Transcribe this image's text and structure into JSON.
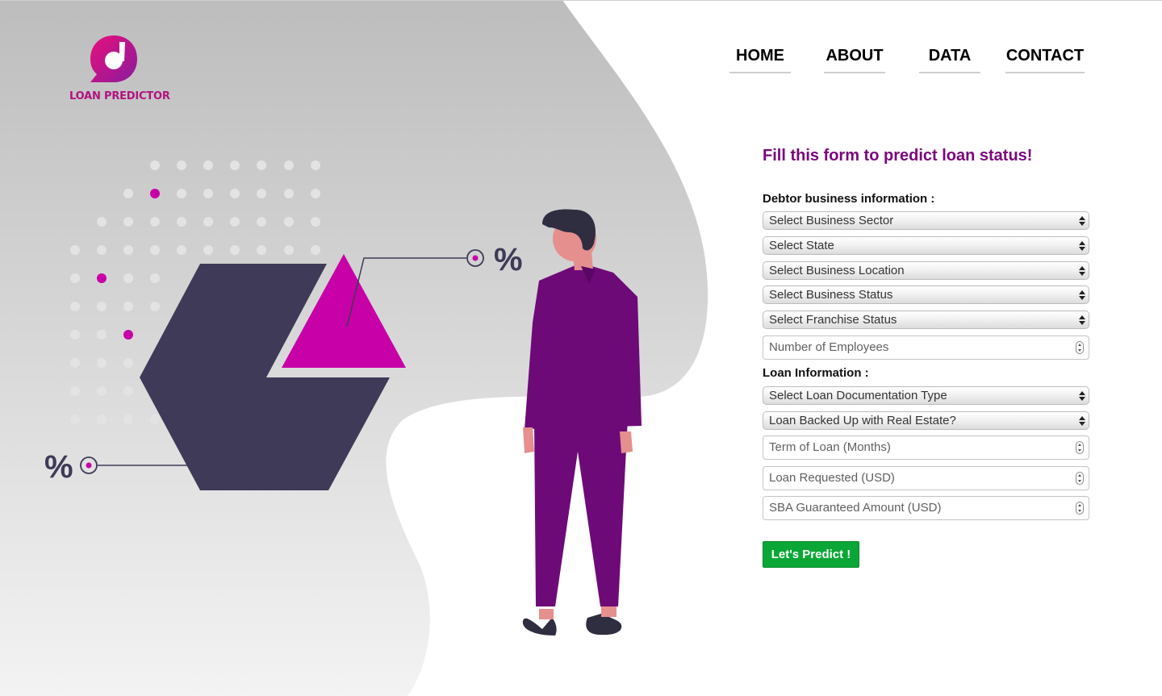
{
  "brand": {
    "logo_text": "LOAN PREDICTOR",
    "primary_color": "#b0137f",
    "accent_purple": "#7b067b"
  },
  "nav": {
    "items": [
      {
        "label": "HOME"
      },
      {
        "label": "ABOUT"
      },
      {
        "label": "DATA"
      },
      {
        "label": "CONTACT"
      }
    ]
  },
  "illustration": {
    "percent_symbol_left": "%",
    "percent_symbol_right": "%"
  },
  "form": {
    "title": "Fill this form to predict loan status!",
    "debtor_section_label": "Debtor business information :",
    "loan_section_label": "Loan Information :",
    "fields": {
      "business_sector": "Select Business Sector",
      "state": "Select State",
      "business_location": "Select Business Location",
      "business_status": "Select Business Status",
      "franchise_status": "Select Franchise Status",
      "employees": "Number of Employees",
      "loan_doc_type": "Select Loan Documentation Type",
      "real_estate": "Loan Backed Up with Real Estate?",
      "term": "Term of Loan (Months)",
      "loan_requested": "Loan Requested (USD)",
      "sba_guaranteed": "SBA Guaranteed Amount (USD)"
    },
    "submit_label": "Let's Predict !",
    "submit_color": "#0aa736"
  }
}
